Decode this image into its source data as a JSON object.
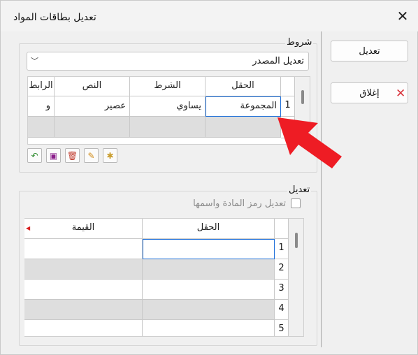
{
  "window": {
    "title": "تعديل بطاقات المواد"
  },
  "buttons": {
    "edit_label": "تعديل",
    "close_label": "إغلاق"
  },
  "conditions": {
    "group_label": "شروط",
    "combo_value": "تعديل المصدر",
    "headers": {
      "field": "الحقل",
      "condition": "الشرط",
      "text": "النص",
      "link": "الرابط"
    },
    "rows": [
      {
        "num": "1",
        "field": "المجموعة",
        "condition": "يساوي",
        "text": "عصير",
        "link": "و"
      },
      {
        "num": "2",
        "field": "",
        "condition": "",
        "text": "",
        "link": ""
      }
    ]
  },
  "edit": {
    "group_label": "تعديل",
    "checkbox_label": "تعديل رمز المادة واسمها",
    "headers": {
      "field": "الحقل",
      "value": "القيمة"
    },
    "rows": [
      {
        "num": "1"
      },
      {
        "num": "2"
      },
      {
        "num": "3"
      },
      {
        "num": "4"
      },
      {
        "num": "5"
      }
    ]
  },
  "colors": {
    "accent_blue": "#1e6fd9",
    "arrow_red": "#ee1c24",
    "delete_red": "#d9363e"
  },
  "toolbar_icons": [
    "undo-icon",
    "save-icon",
    "delete-icon",
    "edit-save-icon",
    "new-document-icon"
  ]
}
